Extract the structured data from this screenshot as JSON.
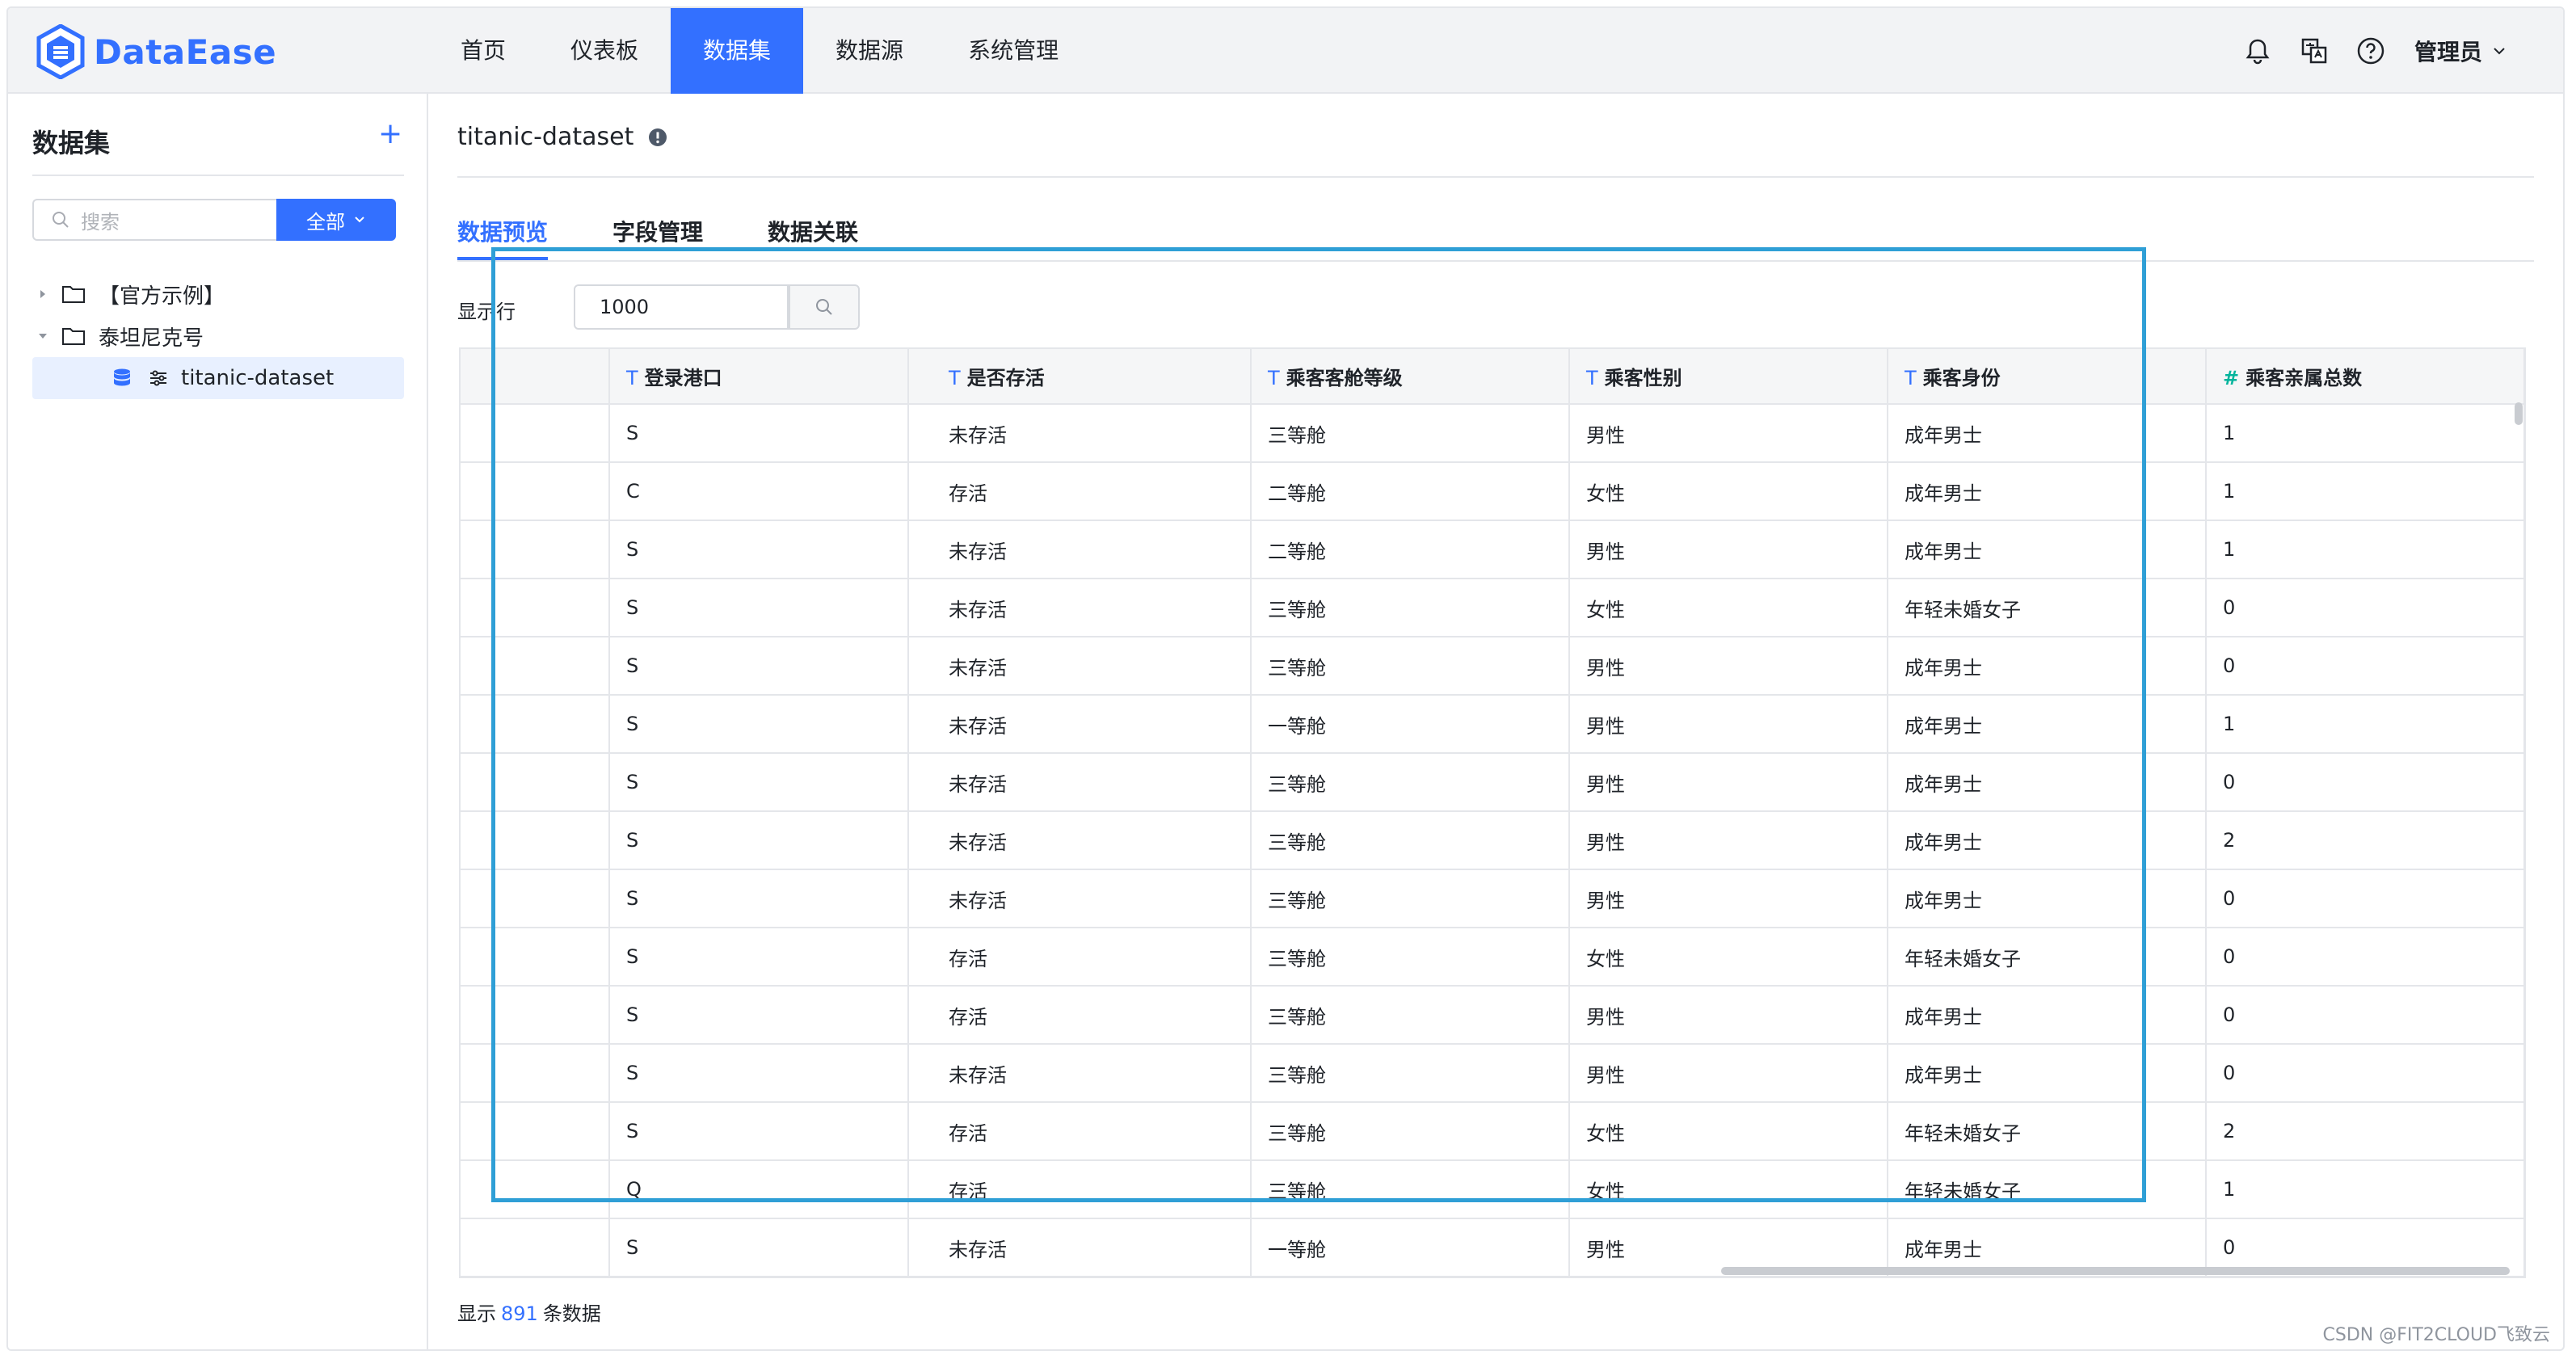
{
  "brand": {
    "name": "DataEase",
    "accent": "#3370ff"
  },
  "nav": [
    {
      "label": "首页",
      "active": false
    },
    {
      "label": "仪表板",
      "active": false
    },
    {
      "label": "数据集",
      "active": true
    },
    {
      "label": "数据源",
      "active": false
    },
    {
      "label": "系统管理",
      "active": false
    }
  ],
  "topbar": {
    "user": "管理员"
  },
  "sidebar": {
    "title": "数据集",
    "search_placeholder": "搜索",
    "filter_label": "全部",
    "tree": [
      {
        "label": "【官方示例】"
      },
      {
        "label": "泰坦尼克号"
      },
      {
        "label": "titanic-dataset"
      }
    ]
  },
  "main": {
    "dataset_name": "titanic-dataset",
    "tabs": [
      {
        "label": "数据预览",
        "active": true
      },
      {
        "label": "字段管理",
        "active": false
      },
      {
        "label": "数据关联",
        "active": false
      }
    ],
    "rows_label": "显示行",
    "rows_value": "1000",
    "footer": {
      "prefix": "显示",
      "count": "891",
      "suffix": "条数据"
    }
  },
  "table": {
    "columns": [
      {
        "type": "T",
        "name": "登录港口"
      },
      {
        "type": "T",
        "name": "是否存活"
      },
      {
        "type": "T",
        "name": "乘客客舱等级"
      },
      {
        "type": "T",
        "name": "乘客性别"
      },
      {
        "type": "T",
        "name": "乘客身份"
      },
      {
        "type": "#",
        "name": "乘客亲属总数"
      }
    ],
    "rows": [
      [
        "S",
        "未存活",
        "三等舱",
        "男性",
        "成年男士",
        "1"
      ],
      [
        "C",
        "存活",
        "二等舱",
        "女性",
        "成年男士",
        "1"
      ],
      [
        "S",
        "未存活",
        "二等舱",
        "男性",
        "成年男士",
        "1"
      ],
      [
        "S",
        "未存活",
        "三等舱",
        "女性",
        "年轻未婚女子",
        "0"
      ],
      [
        "S",
        "未存活",
        "三等舱",
        "男性",
        "成年男士",
        "0"
      ],
      [
        "S",
        "未存活",
        "一等舱",
        "男性",
        "成年男士",
        "1"
      ],
      [
        "S",
        "未存活",
        "三等舱",
        "男性",
        "成年男士",
        "0"
      ],
      [
        "S",
        "未存活",
        "三等舱",
        "男性",
        "成年男士",
        "2"
      ],
      [
        "S",
        "未存活",
        "三等舱",
        "男性",
        "成年男士",
        "0"
      ],
      [
        "S",
        "存活",
        "三等舱",
        "女性",
        "年轻未婚女子",
        "0"
      ],
      [
        "S",
        "存活",
        "三等舱",
        "男性",
        "成年男士",
        "0"
      ],
      [
        "S",
        "未存活",
        "三等舱",
        "男性",
        "成年男士",
        "0"
      ],
      [
        "S",
        "存活",
        "三等舱",
        "女性",
        "年轻未婚女子",
        "2"
      ],
      [
        "Q",
        "存活",
        "三等舱",
        "女性",
        "年轻未婚女子",
        "1"
      ],
      [
        "S",
        "未存活",
        "一等舱",
        "男性",
        "成年男士",
        "0"
      ]
    ]
  },
  "watermark": "CSDN @FIT2CLOUD飞致云"
}
